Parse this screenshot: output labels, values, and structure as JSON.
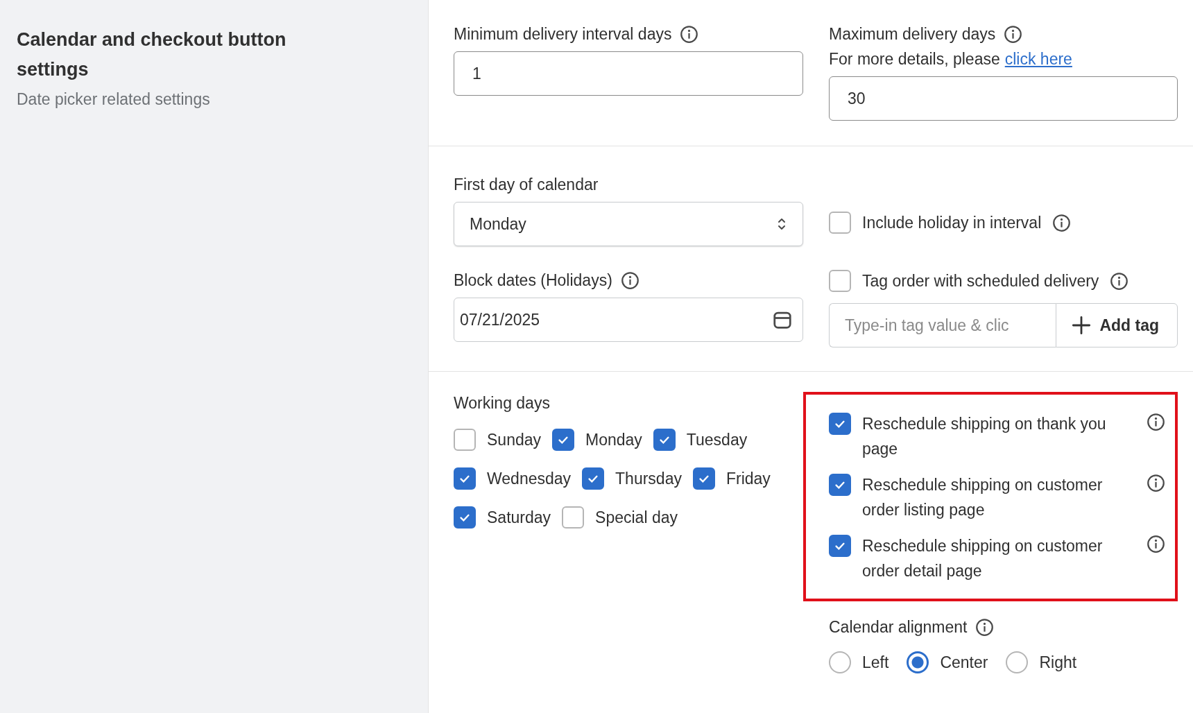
{
  "sidebar": {
    "title": "Calendar and checkout button settings",
    "subtitle": "Date picker related settings"
  },
  "min_interval": {
    "label": "Minimum delivery interval days",
    "value": "1"
  },
  "max_days": {
    "label": "Maximum delivery days",
    "help_text": "For more details, please",
    "link": "click here",
    "value": "30"
  },
  "first_day": {
    "label": "First day of calendar",
    "value": "Monday"
  },
  "include_holiday": {
    "label": "Include holiday in interval",
    "checked": false
  },
  "block_dates": {
    "label": "Block dates (Holidays)",
    "value": "07/21/2025"
  },
  "tag_order": {
    "label": "Tag order with scheduled delivery",
    "checked": false,
    "placeholder": "Type-in tag value & clic",
    "button": "Add tag"
  },
  "working_days": {
    "label": "Working days",
    "days": [
      {
        "label": "Sunday",
        "checked": false
      },
      {
        "label": "Monday",
        "checked": true
      },
      {
        "label": "Tuesday",
        "checked": true
      },
      {
        "label": "Wednesday",
        "checked": true
      },
      {
        "label": "Thursday",
        "checked": true
      },
      {
        "label": "Friday",
        "checked": true
      },
      {
        "label": "Saturday",
        "checked": true
      },
      {
        "label": "Special day",
        "checked": false
      }
    ]
  },
  "reschedule_options": [
    {
      "label": "Reschedule shipping on thank you page",
      "checked": true
    },
    {
      "label": "Reschedule shipping on customer order listing page",
      "checked": true
    },
    {
      "label": "Reschedule shipping on customer order detail page",
      "checked": true
    }
  ],
  "calendar_alignment": {
    "label": "Calendar alignment",
    "options": [
      {
        "label": "Left",
        "selected": false
      },
      {
        "label": "Center",
        "selected": true
      },
      {
        "label": "Right",
        "selected": false
      }
    ]
  }
}
